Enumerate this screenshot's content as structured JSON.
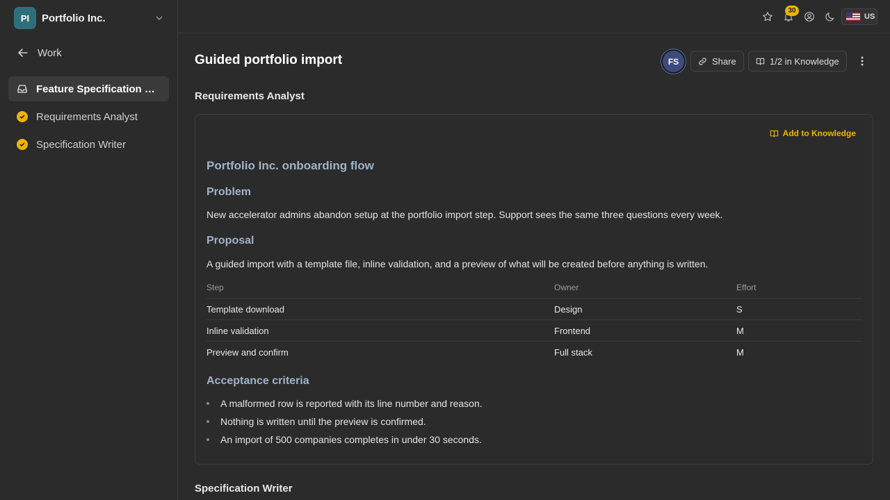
{
  "org": {
    "initials": "PI",
    "name": "Portfolio Inc."
  },
  "sidebar": {
    "back_label": "Work",
    "items": [
      {
        "label": "Feature Specification Do..."
      },
      {
        "label": "Requirements Analyst"
      },
      {
        "label": "Specification Writer"
      }
    ]
  },
  "topbar": {
    "notification_count": "30",
    "locale": "US"
  },
  "page": {
    "title": "Guided portfolio import",
    "author_initials": "FS",
    "share_label": "Share",
    "knowledge_label": "1/2 in Knowledge"
  },
  "sections": {
    "first_title": "Requirements Analyst",
    "second_title": "Specification Writer"
  },
  "card": {
    "add_knowledge_label": "Add to Knowledge",
    "heading": "Portfolio Inc. onboarding flow",
    "problem_heading": "Problem",
    "problem_text": "New accelerator admins abandon setup at the portfolio import step. Support sees the same three questions every week.",
    "proposal_heading": "Proposal",
    "proposal_text": "A guided import with a template file, inline validation, and a preview of what will be created before anything is written.",
    "table": {
      "headers": [
        "Step",
        "Owner",
        "Effort"
      ],
      "rows": [
        [
          "Template download",
          "Design",
          "S"
        ],
        [
          "Inline validation",
          "Frontend",
          "M"
        ],
        [
          "Preview and confirm",
          "Full stack",
          "M"
        ]
      ]
    },
    "criteria_heading": "Acceptance criteria",
    "criteria": [
      "A malformed row is reported with its line number and reason.",
      "Nothing is written until the preview is confirmed.",
      "An import of 500 companies completes in under 30 seconds."
    ]
  },
  "colors": {
    "accent": "#f0b400",
    "heading": "#9fb3c8",
    "org_avatar": "#2f6f7b"
  }
}
